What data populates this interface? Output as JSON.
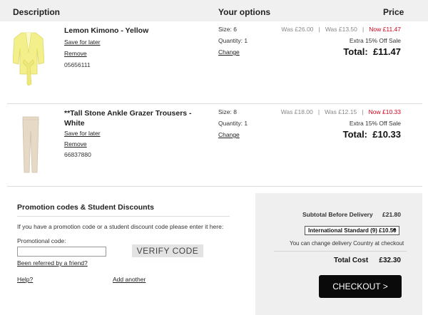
{
  "header": {
    "description": "Description",
    "your_options": "Your options",
    "price": "Price"
  },
  "items": [
    {
      "title": "Lemon Kimono - Yellow",
      "save_for_later": "Save for later",
      "remove": "Remove",
      "code": "05656111",
      "size": "Size: 6",
      "quantity": "Quantity: 1",
      "change": "Change",
      "was1": "Was £26.00",
      "was2": "Was £13.50",
      "now": "Now £11.47",
      "sale_note": "Extra 15% Off Sale",
      "total": "Total:  £11.47",
      "image_color": "#f3ef8a"
    },
    {
      "title_line1": "**Tall Stone Ankle Grazer Trousers -",
      "title_line2": "White",
      "save_for_later": "Save for later",
      "remove": "Remove",
      "code": "66837880",
      "size": "Size: 8",
      "quantity": "Quantity: 1",
      "change": "Change",
      "was1": "Was £18.00",
      "was2": "Was £12.15",
      "now": "Now £10.33",
      "sale_note": "Extra 15% Off Sale",
      "total": "Total:  £10.33",
      "image_color": "#e6d9c6"
    }
  ],
  "promo": {
    "heading": "Promotion codes & Student Discounts",
    "instruction": "If you have a promotion code or a student discount code please enter it here:",
    "label": "Promotional code:",
    "input_value": "",
    "verify_label": "VERIFY CODE",
    "referred_link": "Been referred by a friend?",
    "help_link": "Help?",
    "add_another_link": "Add another"
  },
  "summary": {
    "subtotal_label": "Subtotal Before Delivery",
    "subtotal_value": "£21.80",
    "delivery_option": "International Standard (9) £10.50",
    "delivery_note": "You can change delivery Country at checkout",
    "total_label": "Total Cost",
    "total_value": "£32.30",
    "checkout_label": "CHECKOUT >"
  },
  "colors": {
    "sale_red": "#d0021b",
    "checkout_bg": "#0a0a0a",
    "header_bg": "#f0f0f0",
    "summary_bg": "#efefef"
  }
}
